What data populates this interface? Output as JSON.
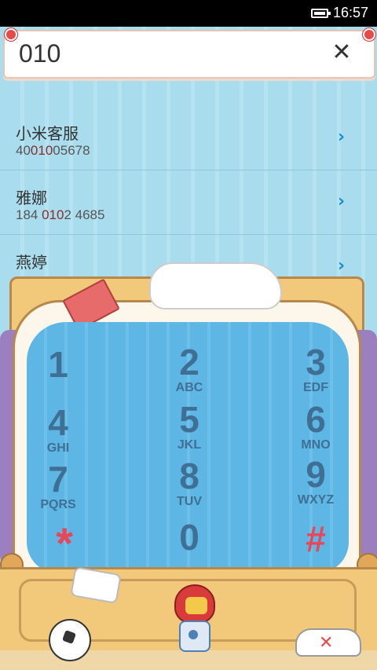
{
  "status_bar": {
    "time": "16:57"
  },
  "search": {
    "query": "010",
    "clear_icon": "close-icon"
  },
  "contacts": [
    {
      "name": "小米客服",
      "number_pre": "40",
      "number_match": "010",
      "number_post": "05678"
    },
    {
      "name": "雅娜",
      "number_pre": "184 ",
      "number_match": "010",
      "number_post": "2 4685"
    },
    {
      "name": "燕婷",
      "number_pre": "",
      "number_match": "",
      "number_post": ""
    }
  ],
  "keypad": [
    {
      "digit": "1",
      "letters": ""
    },
    {
      "digit": "2",
      "letters": "ABC"
    },
    {
      "digit": "3",
      "letters": "EDF"
    },
    {
      "digit": "4",
      "letters": "GHI"
    },
    {
      "digit": "5",
      "letters": "JKL"
    },
    {
      "digit": "6",
      "letters": "MNO"
    },
    {
      "digit": "7",
      "letters": "PQRS"
    },
    {
      "digit": "8",
      "letters": "TUV"
    },
    {
      "digit": "9",
      "letters": "WXYZ"
    },
    {
      "digit": "*",
      "letters": ""
    },
    {
      "digit": "0",
      "letters": ""
    },
    {
      "digit": "#",
      "letters": ""
    }
  ],
  "colors": {
    "accent": "#1a8bd0",
    "key_text": "#3f6f95",
    "symbol_keys": "#e8475a"
  }
}
